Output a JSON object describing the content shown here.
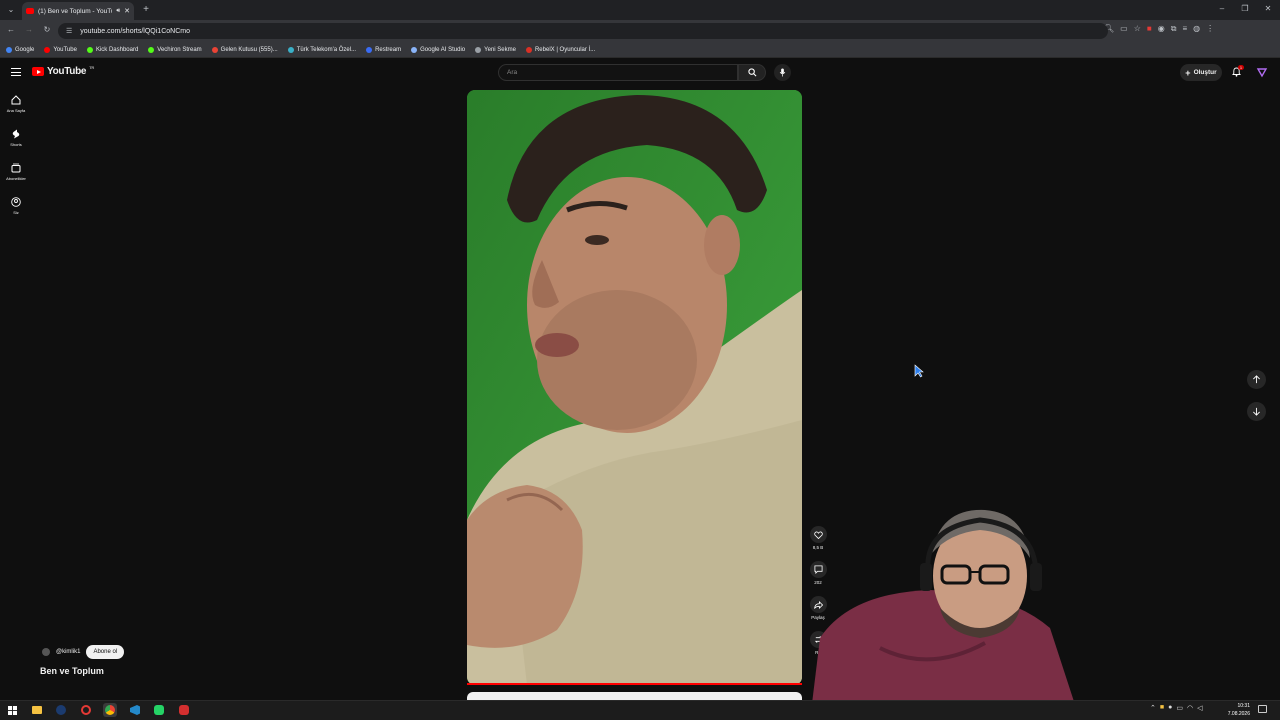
{
  "browser": {
    "tab_title": "(1) Ben ve Toplum - YouTube",
    "url": "youtube.com/shorts/lQQi1CoNCmo",
    "bookmarks": [
      {
        "label": "Google",
        "color": "#4285f4"
      },
      {
        "label": "YouTube",
        "color": "#ff0000"
      },
      {
        "label": "Kick Dashboard",
        "color": "#53fc18"
      },
      {
        "label": "Vechiron Stream",
        "color": "#53fc18"
      },
      {
        "label": "Gelen Kutusu (555)...",
        "color": "#ea4335"
      },
      {
        "label": "Türk Telekom'a Özel...",
        "color": "#3ab0c8"
      },
      {
        "label": "Restream",
        "color": "#3a6cf4"
      },
      {
        "label": "Google AI Studio",
        "color": "#8ab4f8"
      },
      {
        "label": "Yeni Sekme",
        "color": "#9aa0a6"
      },
      {
        "label": "RebelX | Oyuncular İ...",
        "color": "#d93025"
      }
    ]
  },
  "youtube": {
    "logo_text": "YouTube",
    "region": "TR",
    "search_placeholder": "Ara",
    "create_label": "Oluştur",
    "notification_count": "1",
    "sidebar": [
      {
        "label": "Ana Sayfa",
        "icon": "home-icon"
      },
      {
        "label": "Shorts",
        "icon": "shorts-icon"
      },
      {
        "label": "Abonelikler",
        "icon": "subscriptions-icon"
      },
      {
        "label": "Siz",
        "icon": "you-icon"
      }
    ]
  },
  "short": {
    "title": "Ben ve Toplum",
    "channel": "@kimlik1",
    "subscribe_label": "Abone ol",
    "likes": "8,5 B",
    "comments": "202",
    "share_label": "Paylaş",
    "remix_label": "Re"
  },
  "taskbar": {
    "time": "10:31",
    "date": "7.08.2026"
  },
  "colors": {
    "brand_red": "#ff0000",
    "background": "#0f0f0f",
    "green_screen": "#2f8f2f"
  }
}
